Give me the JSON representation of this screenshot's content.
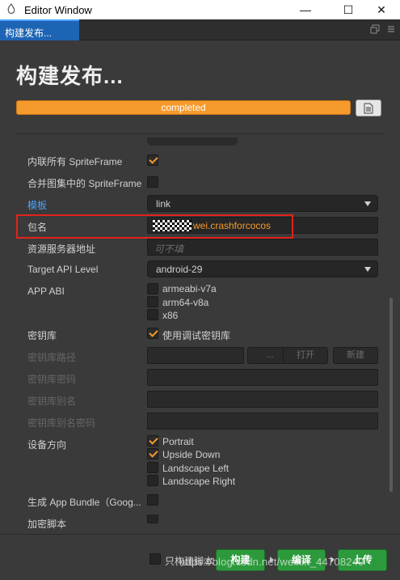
{
  "window": {
    "title": "Editor Window",
    "min_glyph": "—",
    "max_glyph": "☐",
    "close_glyph": "✕"
  },
  "tab": {
    "label": "构建发布..."
  },
  "heading": "构建发布...",
  "progress": {
    "text": "completed",
    "value": 1.0,
    "color": "#f59a2c"
  },
  "rows": {
    "inline_spriteframe": {
      "label": "内联所有 SpriteFrame",
      "checked": true
    },
    "merge_spriteframe": {
      "label": "合并图集中的 SpriteFrame",
      "checked": false
    },
    "template": {
      "label": "模板",
      "value": "link"
    },
    "package_name": {
      "label": "包名",
      "value_visible": "wei.crashforcocos"
    },
    "resource_server": {
      "label": "资源服务器地址",
      "placeholder": "可不填"
    },
    "target_api": {
      "label": "Target API Level",
      "value": "android-29"
    },
    "app_abi": {
      "label": "APP ABI",
      "options": [
        "armeabi-v7a",
        "arm64-v8a",
        "x86"
      ]
    },
    "keystore": {
      "label": "密钥库",
      "option_label": "使用调试密钥库",
      "checked": true
    },
    "keystore_path": {
      "label": "密钥库路径",
      "btn_more": "...",
      "btn_open": "打开",
      "btn_new": "新建"
    },
    "keystore_password": {
      "label": "密钥库密码"
    },
    "keystore_alias": {
      "label": "密钥库别名"
    },
    "keystore_alias_password": {
      "label": "密钥库别名密码"
    },
    "orientation": {
      "label": "设备方向",
      "options": [
        "Portrait",
        "Upside Down",
        "Landscape Left",
        "Landscape Right"
      ],
      "checked": [
        true,
        true,
        false,
        false
      ]
    },
    "app_bundle": {
      "label": "生成 App Bundle（Goog..."
    },
    "encrypt": {
      "label": "加密脚本"
    }
  },
  "footer": {
    "only_script": "只构建脚本",
    "build": "构建",
    "compile": "编译",
    "upload": "上传"
  },
  "watermark": "https://blog.csdn.net/weixin_44708240",
  "colors": {
    "accent": "#f59a2c",
    "link": "#4aa3ff",
    "green": "#2c9a3c",
    "highlight": "#e2231a"
  }
}
